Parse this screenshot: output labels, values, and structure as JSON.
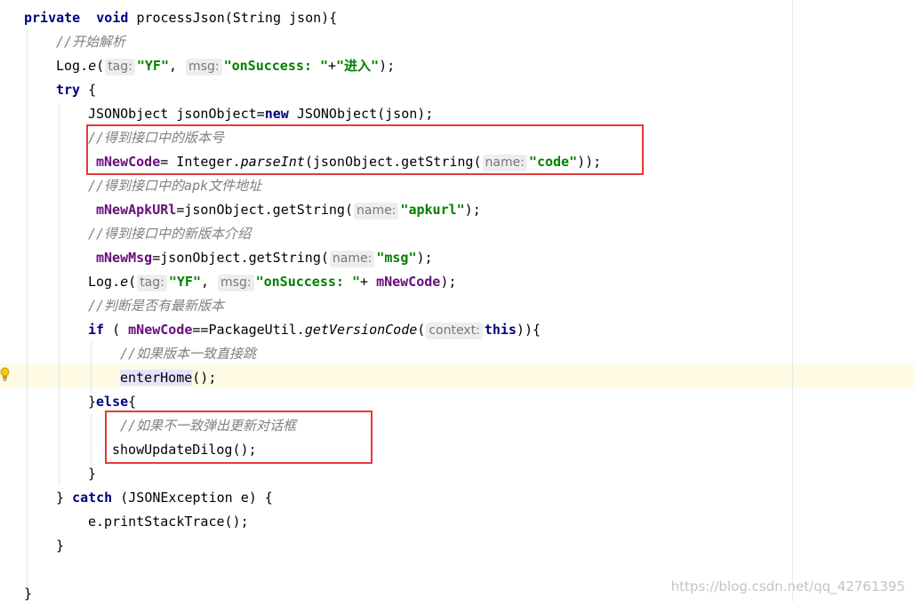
{
  "code": {
    "l1": {
      "kw1": "private",
      "kw2": "void",
      "rest": "processJson(String json){"
    },
    "l2": {
      "comment": "//开始解析"
    },
    "l3": {
      "a": "Log.",
      "m": "e",
      "b": "(",
      "h1": "tag:",
      "s1": "\"YF\"",
      "c": ",",
      "h2": "msg:",
      "s2": "\"onSuccess: \"",
      "d": "+",
      "s3": "\"进入\"",
      "e": ");"
    },
    "l4": {
      "kw": "try",
      "rest": "{"
    },
    "l5": {
      "a": "JSONObject jsonObject=",
      "kw": "new",
      "b": "JSONObject(json);"
    },
    "l6": {
      "comment": "//得到接口中的版本号"
    },
    "l7": {
      "f": "mNewCode",
      "a": "= Integer.",
      "m": "parseInt",
      "b": "(jsonObject.getString(",
      "h": "name:",
      "s": "\"code\"",
      "c": "));"
    },
    "l8": {
      "comment": "//得到接口中的apk文件地址"
    },
    "l9": {
      "f": "mNewApkURl",
      "a": "=jsonObject.getString(",
      "h": "name:",
      "s": "\"apkurl\"",
      "c": ");"
    },
    "l10": {
      "comment": "//得到接口中的新版本介绍"
    },
    "l11": {
      "f": "mNewMsg",
      "a": "=jsonObject.getString(",
      "h": "name:",
      "s": "\"msg\"",
      "c": ");"
    },
    "l12": {
      "a": "Log.",
      "m": "e",
      "b": "(",
      "h1": "tag:",
      "s1": "\"YF\"",
      "c": ",",
      "h2": "msg:",
      "s2": "\"onSuccess: \"",
      "d": "+ ",
      "f": "mNewCode",
      "e": ");"
    },
    "l13": {
      "comment": "//判断是否有最新版本"
    },
    "l14": {
      "kw": "if",
      "a": " ( ",
      "f": "mNewCode",
      "b": "==PackageUtil.",
      "m": "getVersionCode",
      "c": "(",
      "h": "context:",
      "kw2": "this",
      "d": ")){"
    },
    "l15": {
      "comment": "//如果版本一致直接跳"
    },
    "l16": {
      "m": "enterHome",
      "a": "();"
    },
    "l17": {
      "a": "}",
      "kw": "else",
      "b": "{"
    },
    "l18": {
      "comment": "//如果不一致弹出更新对话框"
    },
    "l19": {
      "a": "showUpdateDilog();"
    },
    "l20": {
      "a": "}"
    },
    "l21": {
      "a": "} ",
      "kw": "catch",
      "b": " (JSONException e) {"
    },
    "l22": {
      "a": "e.printStackTrace();"
    },
    "l23": {
      "a": "}"
    },
    "l24": {
      "a": "}"
    }
  },
  "watermark": "https://blog.csdn.net/qq_42761395",
  "colors": {
    "keyword": "#000080",
    "field": "#660e7a",
    "string": "#008000",
    "comment": "#808080",
    "highlight_box": "#e33a3a",
    "current_line": "#fffae3"
  }
}
